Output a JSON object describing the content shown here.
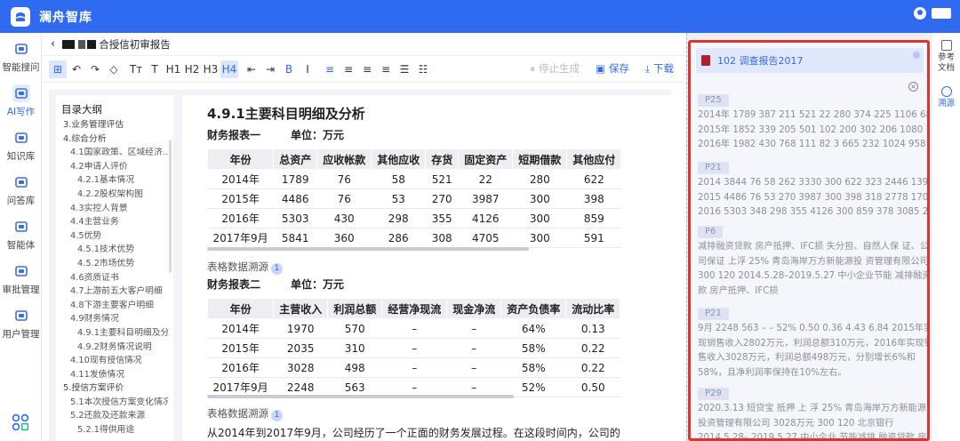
{
  "app": {
    "title": "澜舟智库"
  },
  "nav": [
    {
      "label": "智能搜问",
      "icon": "chat-icon"
    },
    {
      "label": "AI写作",
      "icon": "ai-write-icon",
      "active": true
    },
    {
      "label": "知识库",
      "icon": "library-icon"
    },
    {
      "label": "问答库",
      "icon": "qa-icon"
    },
    {
      "label": "智能体",
      "icon": "robot-icon"
    },
    {
      "label": "审批管理",
      "icon": "approval-icon"
    },
    {
      "label": "用户管理",
      "icon": "users-icon"
    }
  ],
  "doc": {
    "title": "合授信初审报告"
  },
  "toolbar": {
    "stop": "停止生成",
    "save": "保存",
    "download": "下载",
    "buttons": [
      "⊞",
      "↶",
      "↷",
      "◇",
      "Tт",
      "T",
      "H1",
      "H2",
      "H3",
      "H4",
      "⇤",
      "⇥",
      "B",
      "I",
      "≡",
      "≡",
      "≡",
      "≡",
      "☰",
      "☷"
    ]
  },
  "outline": {
    "title": "目录大纲",
    "items": [
      {
        "text": "3.业务管理评估",
        "lv": 1
      },
      {
        "text": "4.综合分析",
        "lv": 1
      },
      {
        "text": "4.1国家政策、区域经济...",
        "lv": 2
      },
      {
        "text": "4.2申请人评价",
        "lv": 2
      },
      {
        "text": "4.2.1基本情况",
        "lv": 3
      },
      {
        "text": "4.2.2股权架构图",
        "lv": 3
      },
      {
        "text": "4.3实控人背景",
        "lv": 2
      },
      {
        "text": "4.4主营业务",
        "lv": 2
      },
      {
        "text": "4.5优势",
        "lv": 2
      },
      {
        "text": "4.5.1技术优势",
        "lv": 3
      },
      {
        "text": "4.5.2市场优势",
        "lv": 3
      },
      {
        "text": "4.6资质证书",
        "lv": 2
      },
      {
        "text": "4.7上游前五大客户明细",
        "lv": 2
      },
      {
        "text": "4.8下游主要客户明细",
        "lv": 2
      },
      {
        "text": "4.9财务情况",
        "lv": 2
      },
      {
        "text": "4.9.1主要科目明细及分析",
        "lv": 3
      },
      {
        "text": "4.9.2财务情况说明",
        "lv": 3
      },
      {
        "text": "4.10现有授信情况",
        "lv": 2
      },
      {
        "text": "4.11发债情况",
        "lv": 2
      },
      {
        "text": "5.授信方案评价",
        "lv": 1
      },
      {
        "text": "5.1本次授信方案变化情况",
        "lv": 2
      },
      {
        "text": "5.2还款及还款来源",
        "lv": 2
      },
      {
        "text": "5.2.1得供用途",
        "lv": 3
      }
    ]
  },
  "editor": {
    "heading": "4.9.1主要科目明细及分析",
    "t1": {
      "caption": "财务报表一",
      "unit": "单位：万元",
      "headers": [
        "年份",
        "总资产",
        "应收帐款",
        "其他应收",
        "存货",
        "固定资产",
        "短期借款",
        "其他应付"
      ],
      "rows": [
        [
          "2014年",
          "1789",
          "76",
          "58",
          "521",
          "22",
          "280",
          "622"
        ],
        [
          "2015年",
          "4486",
          "76",
          "53",
          "270",
          "3987",
          "300",
          "398"
        ],
        [
          "2016年",
          "5303",
          "430",
          "298",
          "355",
          "4126",
          "300",
          "859"
        ],
        [
          "2017年9月",
          "5841",
          "360",
          "286",
          "308",
          "4705",
          "300",
          "591"
        ]
      ]
    },
    "src1": "表格数据溯源",
    "src1_badge": "1",
    "t2": {
      "caption": "财务报表二",
      "unit": "单位：万元",
      "headers": [
        "年份",
        "主营收入",
        "利润总额",
        "经营净现流",
        "现金净流",
        "资产负债率",
        "流动比率"
      ],
      "rows": [
        [
          "2014年",
          "1970",
          "570",
          "–",
          "–",
          "64%",
          "0.13"
        ],
        [
          "2015年",
          "2035",
          "310",
          "–",
          "–",
          "58%",
          "0.22"
        ],
        [
          "2016年",
          "3028",
          "498",
          "–",
          "–",
          "58%",
          "0.22"
        ],
        [
          "2017年9月",
          "2248",
          "563",
          "–",
          "–",
          "52%",
          "0.50"
        ]
      ]
    },
    "src2": "表格数据溯源",
    "src2_badge": "1",
    "para": "从2014年到2017年9月，公司经历了一个正面的财务发展过程。在这段时间内，公司的"
  },
  "refpanel": {
    "doc": "102         调查报告2017",
    "chunks": [
      {
        "page": "P25",
        "lines": [
          "2014年 1789 387 211 521 22 280 374 225 1106 683",
          "2015年 1852 339 205 501 102 200 302 206 1080 771",
          "2016年 1982 430 768 111 82 3 665 232 1024 958"
        ]
      },
      {
        "page": "P21",
        "lines": [
          "2014 3844 76 58 262 3330 300 622 323 2446 1398",
          "2015 4486 76 53 270 3987 300 398 318 2778 1708",
          "2016 5303 348 298 355 4126 300 859 378 3085 2218"
        ]
      },
      {
        "page": "P6",
        "lines": [
          "减排融资贷款 房产抵押、IFC损 失分担、自然人保 证、公",
          "司保证 上浮 25% 青岛海岸万方新能源投 资管理有限公司",
          "300 120 2014.5.28–2019.5.27 中小企业节能 减排融资贷",
          "款 房产抵押、IFC损"
        ]
      },
      {
        "page": "P21",
        "lines": [
          "9月 2248 563 – – 52% 0.50 0.36 4.43 6.84 2015年实",
          "现销售收入2802万元，利润总额310万元，2016年实现销",
          "售收入3028万元，利润总额498万元，分别增长6%和",
          "58%，且净利润率保持在10%左右。"
        ]
      },
      {
        "page": "P29",
        "lines": [
          "2020.3.13 短贷宝 抵押 上 浮 25% 青岛海岸万方新能源",
          "投资管理有限公司 3028万元 300 120 北京银行",
          "2014.5.28– 2019.5.27 中小企业 节能减排 融资贷款 房产"
        ]
      }
    ]
  },
  "rail": [
    {
      "label": "参考文档"
    },
    {
      "label": "溯源",
      "active": true
    }
  ]
}
